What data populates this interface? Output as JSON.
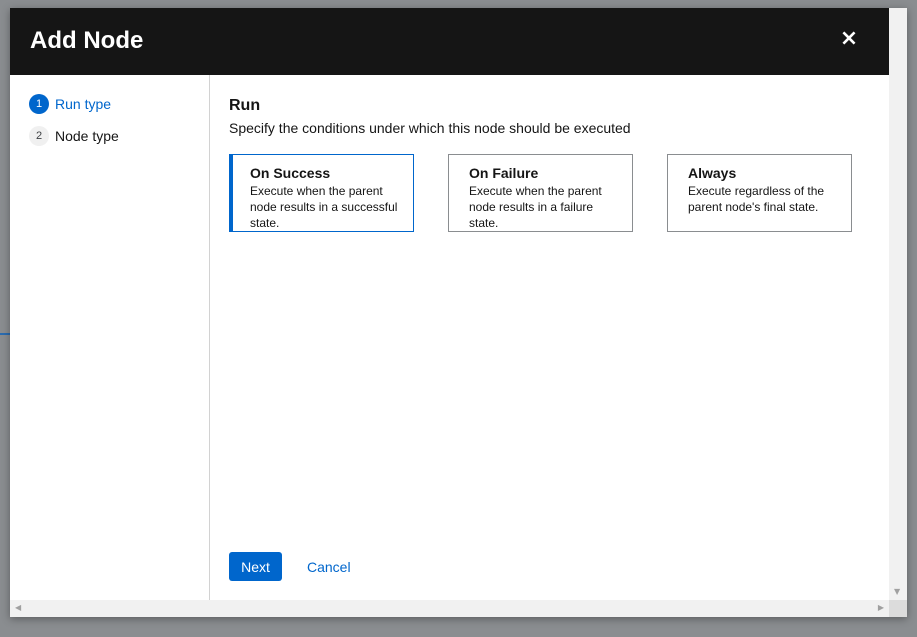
{
  "modal": {
    "title": "Add Node",
    "close_label": "×"
  },
  "wizard_nav": {
    "steps": [
      {
        "number": "1",
        "label": "Run type",
        "active": true
      },
      {
        "number": "2",
        "label": "Node type",
        "active": false
      }
    ]
  },
  "run_step": {
    "title": "Run",
    "description": "Specify the conditions under which this node should be executed",
    "options": [
      {
        "title": "On Success",
        "description": "Execute when the parent node results in a successful state.",
        "selected": true
      },
      {
        "title": "On Failure",
        "description": "Execute when the parent node results in a failure state.",
        "selected": false
      },
      {
        "title": "Always",
        "description": "Execute regardless of the parent node's final state.",
        "selected": false
      }
    ]
  },
  "footer": {
    "next_label": "Next",
    "cancel_label": "Cancel"
  },
  "scrollbars": {
    "down_arrow": "▼",
    "left_arrow": "◀",
    "right_arrow": "▶"
  },
  "colors": {
    "accent": "#0066cc",
    "header_bg": "#151515",
    "backdrop": "#8a8d90"
  }
}
